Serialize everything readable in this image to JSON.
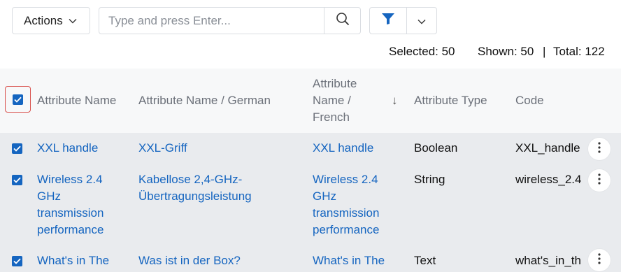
{
  "toolbar": {
    "actions_label": "Actions",
    "search_placeholder": "Type and press Enter...",
    "icons": {
      "chevron": "chevron-down-icon",
      "search": "search-icon",
      "filter": "filter-icon"
    },
    "accent_color": "#1565c0"
  },
  "stats": {
    "selected": "Selected: 50",
    "shown": "Shown: 50",
    "separator": "|",
    "total": "Total: 122"
  },
  "table": {
    "headers": {
      "name": "Attribute Name",
      "german": "Attribute Name / German",
      "french": "Attribute Name / French",
      "sort_indicator": "↓",
      "type": "Attribute Type",
      "code": "Code"
    },
    "rows": [
      {
        "selected": true,
        "name": "XXL handle",
        "german": "XXL-Griff",
        "french": "XXL handle",
        "type": "Boolean",
        "code": "XXL_handle"
      },
      {
        "selected": true,
        "name": "Wireless 2.4 GHz transmission performance",
        "german": "Kabellose 2,4-GHz-Übertragungsleistung",
        "french": "Wireless 2.4 GHz transmission performance",
        "type": "String",
        "code": "wireless_2.4"
      },
      {
        "selected": true,
        "name": "What's in The",
        "german": "Was ist in der Box?",
        "french": "What's in The",
        "type": "Text",
        "code": "what's_in_th"
      }
    ]
  }
}
